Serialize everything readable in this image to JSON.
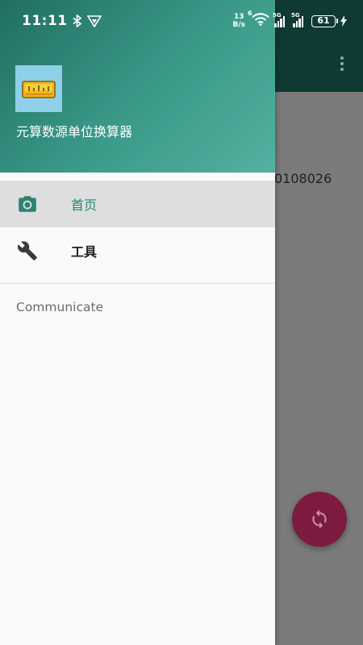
{
  "status_bar": {
    "time": "11:11",
    "net_speed_value": "13",
    "net_speed_unit": "B/s",
    "signal1_tag": "5G",
    "signal2_tag": "5G",
    "wifi_tag": "6",
    "battery_level": "61"
  },
  "drawer": {
    "app_name": "元算数源单位换算器",
    "items": [
      {
        "label": "首页",
        "icon": "camera-icon",
        "selected": true
      },
      {
        "label": "工具",
        "icon": "wrench-icon",
        "selected": false
      }
    ],
    "section_header": "Communicate"
  },
  "background": {
    "partial_text": "0108026",
    "fab_icon": "refresh-icon",
    "overflow_icon": "more-vert-icon"
  },
  "colors": {
    "accent": "#2b8373",
    "header_gradient_start": "#1f6f62",
    "header_gradient_end": "#54b09f",
    "fab": "#7c1b3f"
  }
}
